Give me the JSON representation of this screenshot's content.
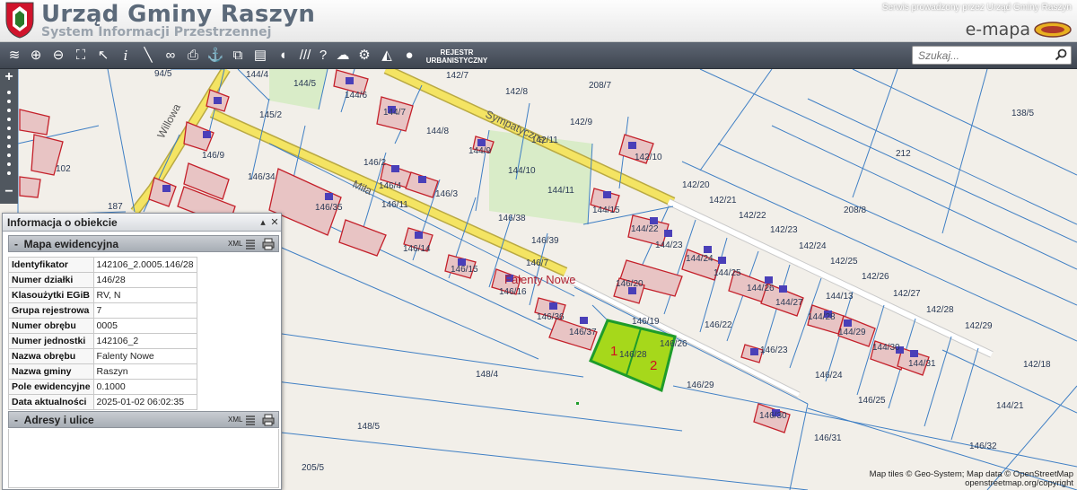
{
  "header": {
    "title": "Urząd Gminy Raszyn",
    "subtitle": "System Informacji Przestrzennej",
    "service_note": "Serwis prowadzony przez Urząd Gminy Raszyn",
    "brand": "e-mapa"
  },
  "toolbar": {
    "icons": [
      "layers-icon",
      "zoom-in-icon",
      "zoom-out-icon",
      "zoom-extent-icon",
      "select-arrow-icon",
      "info-icon",
      "measure-icon",
      "link-icon",
      "print-icon",
      "anchor-icon",
      "export-icon",
      "layout-icon",
      "comment-icon",
      "hatch-icon",
      "help-icon",
      "cloud-download-icon",
      "settings-icon",
      "legend-icon",
      "user-map-icon"
    ],
    "rejestr_label_1": "REJESTR",
    "rejestr_label_2": "URBANISTYCZNY"
  },
  "search": {
    "placeholder": "Szukaj..."
  },
  "colors": {
    "toolbar": "#4c535d",
    "road": "#f4e463",
    "parcel_highlight": "#a6d81b",
    "building": "#e8c4c4"
  },
  "panel": {
    "title": "Informacja o obiekcie",
    "section1": {
      "label": "Mapa ewidencyjna",
      "xml": "XML"
    },
    "rows": [
      {
        "k": "Identyfikator",
        "v": "142106_2.0005.146/28"
      },
      {
        "k": "Numer działki",
        "v": "146/28"
      },
      {
        "k": "Klasoużytki EGiB",
        "v": "RV, N"
      },
      {
        "k": "Grupa rejestrowa",
        "v": "7"
      },
      {
        "k": "Numer obrębu",
        "v": "0005"
      },
      {
        "k": "Numer jednostki",
        "v": "142106_2"
      },
      {
        "k": "Nazwa obrębu",
        "v": "Falenty Nowe"
      },
      {
        "k": "Nazwa gminy",
        "v": "Raszyn"
      },
      {
        "k": "Pole ewidencyjne",
        "v": "0.1000"
      },
      {
        "k": "Data aktualności",
        "v": "2025-01-02 06:02:35"
      }
    ],
    "section2": {
      "label": "Adresy i ulice",
      "xml": "XML"
    }
  },
  "map": {
    "streets": [
      "Willowa",
      "Sympatyczna",
      "Miła"
    ],
    "place": "Falenty Nowe",
    "highlight_labels": [
      "1",
      "2"
    ],
    "parcels": [
      "94/5",
      "144/4",
      "142/7",
      "142/8",
      "208/7",
      "144/5",
      "144/6",
      "145/2",
      "144/7",
      "144/8",
      "142/9",
      "142/11",
      "144/9",
      "102",
      "146/9",
      "146/34",
      "146/2",
      "146/4",
      "146/3",
      "146/35",
      "146/11",
      "144/10",
      "144/11",
      "142/10",
      "138/5",
      "212",
      "142/20",
      "142/21",
      "142/22",
      "208/8",
      "144/15",
      "146/38",
      "146/39",
      "144/22",
      "144/23",
      "142/23",
      "142/24",
      "146/14",
      "146/15",
      "146/7",
      "144/24",
      "144/25",
      "142/25",
      "142/26",
      "142/27",
      "146/16",
      "146/20",
      "144/26",
      "144/27",
      "144/13",
      "146/36",
      "146/37",
      "146/19",
      "146/22",
      "144/28",
      "144/29",
      "142/28",
      "142/29",
      "146/26",
      "146/23",
      "144/30",
      "144/31",
      "148/4",
      "146/28",
      "146/24",
      "142/18",
      "146/29",
      "146/25",
      "144/21",
      "146/30",
      "146/31",
      "146/32",
      "148/5",
      "205/5",
      "187"
    ]
  },
  "credits": {
    "line1": "Map tiles © Geo-System; Map data © OpenStreetMap",
    "line2": "openstreetmap.org/copyright"
  }
}
